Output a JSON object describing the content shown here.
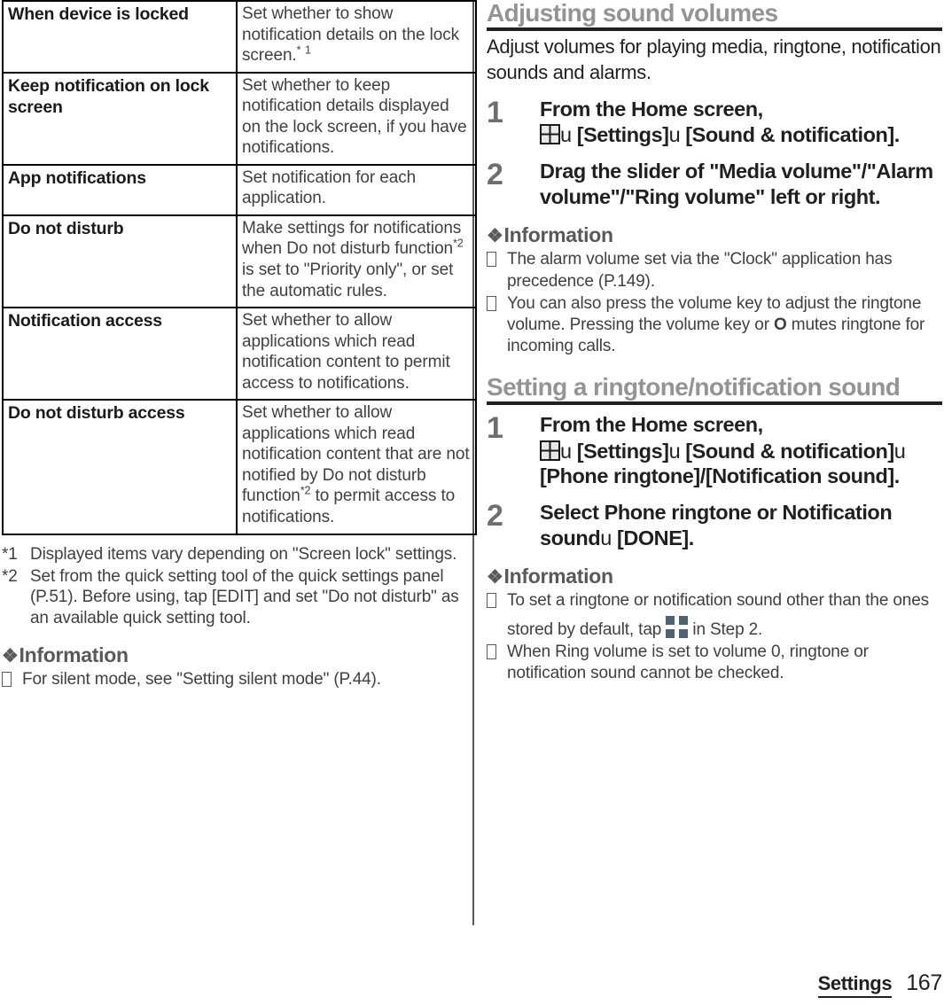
{
  "left_column": {
    "table": {
      "rows": [
        {
          "setting": "When device is locked",
          "description_pre": "Set whether to show notification details on the lock screen.",
          "description_sup": "* 1"
        },
        {
          "setting": "Keep notification on lock screen",
          "description_pre": "Set whether to keep notification details displayed on the lock screen, if you have notifications.",
          "description_sup": ""
        },
        {
          "setting": "App notifications",
          "description_pre": "Set notification for each application.",
          "description_sup": ""
        },
        {
          "setting": "Do not disturb",
          "description_pre": "Make settings for notifications when Do not disturb function",
          "description_sup": "*2",
          "description_post": " is set to \"Priority only\", or set the automatic rules."
        },
        {
          "setting": "Notification access",
          "description_pre": "Set whether to allow applications which read notification content to permit access to notifications.",
          "description_sup": ""
        },
        {
          "setting": "Do not disturb access",
          "description_pre": "Set whether to allow applications which read notification content that are not notified by Do not disturb function",
          "description_sup": "*2",
          "description_post": " to permit access to notifications."
        }
      ]
    },
    "footnotes": [
      {
        "mark": "*1",
        "text": "Displayed items vary depending on \"Screen lock\" settings."
      },
      {
        "mark": "*2",
        "text": "Set from the quick setting tool of the quick settings panel (P.51). Before using, tap [EDIT] and set \"Do not disturb\" as an available quick setting tool."
      }
    ],
    "information": {
      "diamond": "❖",
      "title": "Information",
      "items": [
        {
          "text": "For silent mode, see \"Setting silent mode\" (P.44)."
        }
      ]
    }
  },
  "right_column": {
    "section1": {
      "heading": "Adjusting sound volumes",
      "intro": "Adjust volumes for playing media, ringtone, notification sounds and alarms.",
      "steps": [
        {
          "number": "1",
          "line1": "From the Home screen,",
          "arrow1": "u",
          "part1": " [Settings]",
          "arrow2": "u",
          "part2": " [Sound & notification].",
          "icon": "app-drawer-icon"
        },
        {
          "number": "2",
          "text": "Drag the slider of \"Media volume\"/\"Alarm volume\"/\"Ring volume\" left or right."
        }
      ],
      "information": {
        "diamond": "❖",
        "title": "Information",
        "items": [
          {
            "text_pre": "The alarm volume set via the \"Clock\" application has precedence (P.149).",
            "text_post": ""
          },
          {
            "text_pre": "You can also press the volume key to adjust the ringtone volume. Pressing the volume key or ",
            "key_glyph": "O",
            "text_post": " mutes ringtone for incoming calls."
          }
        ]
      }
    },
    "section2": {
      "heading": "Setting a ringtone/notification sound",
      "steps": [
        {
          "number": "1",
          "line1": "From the Home screen,",
          "arrow1": "u",
          "part1": " [Settings]",
          "arrow2": "u",
          "part2": " [Sound & notification]",
          "arrow3": "u",
          "part3": " [Phone ringtone]/[Notification sound].",
          "icon": "app-drawer-icon"
        },
        {
          "number": "2",
          "part1": "Select Phone ringtone or Notification sound",
          "arrow1": "u",
          "part2": " [DONE]."
        }
      ],
      "information": {
        "diamond": "❖",
        "title": "Information",
        "items": [
          {
            "text_pre": "To set a ringtone or notification sound other than the ones stored by default, tap ",
            "icon": "plus-icon",
            "text_post": " in Step 2."
          },
          {
            "text_pre": "When Ring volume is set to volume 0, ringtone or notification sound cannot be checked.",
            "text_post": ""
          }
        ]
      }
    }
  },
  "footer": {
    "label": "Settings",
    "page_number": "167"
  }
}
